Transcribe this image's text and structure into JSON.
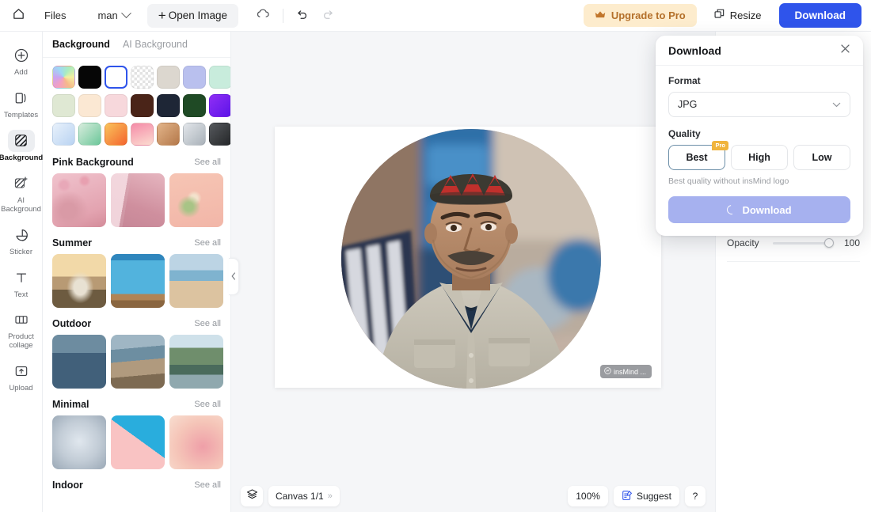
{
  "topbar": {
    "home_icon": "home-icon",
    "files_label": "Files",
    "doc_name": "man",
    "open_image_label": "Open Image",
    "cloud_icon": "cloud-sync-icon",
    "undo_icon": "undo-icon",
    "redo_icon": "redo-icon",
    "upgrade_label": "Upgrade to Pro",
    "upgrade_icon": "crown-icon",
    "resize_label": "Resize",
    "resize_icon": "resize-icon",
    "download_label": "Download",
    "accent_blue": "#2f54eb",
    "upgrade_bg": "#fdeccd",
    "upgrade_fg": "#b4702a"
  },
  "rail": {
    "items": [
      {
        "label": "Add",
        "icon": "plus-circle-icon",
        "active": false
      },
      {
        "label": "Templates",
        "icon": "templates-icon",
        "active": false
      },
      {
        "label": "Background",
        "icon": "background-icon",
        "active": true
      },
      {
        "label": "AI Background",
        "icon": "ai-background-icon",
        "active": false
      },
      {
        "label": "Sticker",
        "icon": "sticker-icon",
        "active": false
      },
      {
        "label": "Text",
        "icon": "text-icon",
        "active": false
      },
      {
        "label": "Product collage",
        "icon": "product-collage-icon",
        "active": false
      },
      {
        "label": "Upload",
        "icon": "upload-icon",
        "active": false
      }
    ]
  },
  "panel": {
    "tabs": [
      {
        "label": "Background",
        "active": true
      },
      {
        "label": "AI Background",
        "active": false
      }
    ],
    "swatches": [
      {
        "name": "rainbow-gradient",
        "kind": "rainbow",
        "color": ""
      },
      {
        "name": "black",
        "kind": "solid",
        "color": "#060606"
      },
      {
        "name": "white-selected",
        "kind": "solid",
        "color": "#ffffff",
        "selected": true
      },
      {
        "name": "transparent",
        "kind": "checker",
        "color": ""
      },
      {
        "name": "warm-gray",
        "kind": "solid",
        "color": "#dcd7cf"
      },
      {
        "name": "periwinkle",
        "kind": "solid",
        "color": "#b9c0ee"
      },
      {
        "name": "mint",
        "kind": "solid",
        "color": "#c8ecdc"
      },
      {
        "name": "pale-green",
        "kind": "solid",
        "color": "#dfe8d3"
      },
      {
        "name": "cream",
        "kind": "solid",
        "color": "#fbe8d3"
      },
      {
        "name": "blush",
        "kind": "solid",
        "color": "#f7d8dc"
      },
      {
        "name": "dark-brown",
        "kind": "solid",
        "color": "#4a2418"
      },
      {
        "name": "navy",
        "kind": "solid",
        "color": "#1e2636"
      },
      {
        "name": "forest-green",
        "kind": "solid",
        "color": "#1f4a25"
      },
      {
        "name": "violet",
        "kind": "gradient",
        "color": "#7a2df0"
      },
      {
        "name": "ice-blue-gradient",
        "kind": "gradient",
        "color": "#cfe0f7"
      },
      {
        "name": "green-gradient",
        "kind": "gradient",
        "color": "#8fd6a8"
      },
      {
        "name": "orange-gradient",
        "kind": "gradient",
        "color": "#f58a3c"
      },
      {
        "name": "pink-gradient",
        "kind": "gradient",
        "color": "#f2a0b4"
      },
      {
        "name": "tan-gradient",
        "kind": "gradient",
        "color": "#cf9a6c"
      },
      {
        "name": "silver-gradient",
        "kind": "gradient",
        "color": "#c2c8ce"
      },
      {
        "name": "charcoal-gradient",
        "kind": "gradient",
        "color": "#3b3d40"
      }
    ],
    "sections": [
      {
        "title": "Pink Background",
        "see_all": "See all",
        "thumbs": [
          {
            "name": "pink-blossom-podium"
          },
          {
            "name": "pink-window-room"
          },
          {
            "name": "pink-tulips"
          }
        ]
      },
      {
        "title": "Summer",
        "see_all": "See all",
        "thumbs": [
          {
            "name": "palm-sunset-podium"
          },
          {
            "name": "pool-water-deck"
          },
          {
            "name": "beach-sand-sea"
          }
        ]
      },
      {
        "title": "Outdoor",
        "see_all": "See all",
        "thumbs": [
          {
            "name": "palms-water-reflection"
          },
          {
            "name": "rocky-coastline"
          },
          {
            "name": "mountain-lake"
          }
        ]
      },
      {
        "title": "Minimal",
        "see_all": "See all",
        "thumbs": [
          {
            "name": "gray-blue-radial"
          },
          {
            "name": "cyan-pink-diagonal"
          },
          {
            "name": "peach-pink-blur"
          }
        ]
      },
      {
        "title": "Indoor",
        "see_all": "See all",
        "thumbs": []
      }
    ],
    "collapse_icon": "chevron-left-icon"
  },
  "canvas": {
    "watermark_text": "insMind ...",
    "watermark_icon": "insmind-logo-icon",
    "photo_alt": "portrait-of-man-in-embroidered-cap"
  },
  "rightpanel": {
    "opacity_label": "Opacity",
    "opacity_value": "100"
  },
  "modal": {
    "title": "Download",
    "close_icon": "close-icon",
    "format_label": "Format",
    "format_value": "JPG",
    "format_chevron": "chevron-down-icon",
    "quality_label": "Quality",
    "quality_options": [
      {
        "label": "Best",
        "selected": true,
        "pro": true,
        "pro_label": "Pro"
      },
      {
        "label": "High",
        "selected": false,
        "pro": false,
        "pro_label": ""
      },
      {
        "label": "Low",
        "selected": false,
        "pro": false,
        "pro_label": ""
      }
    ],
    "quality_hint": "Best quality without insMind logo",
    "download_label": "Download",
    "download_loading": true,
    "download_bg": "#a6b1ef",
    "pro_badge_color": "#f0b43c"
  },
  "bottombar": {
    "layers_icon": "layers-icon",
    "canvas_label": "Canvas 1/1",
    "canvas_chevron": "double-chevron-right-icon",
    "zoom_label": "100%",
    "suggest_label": "Suggest",
    "suggest_icon": "suggest-note-icon",
    "help_label": "?"
  }
}
